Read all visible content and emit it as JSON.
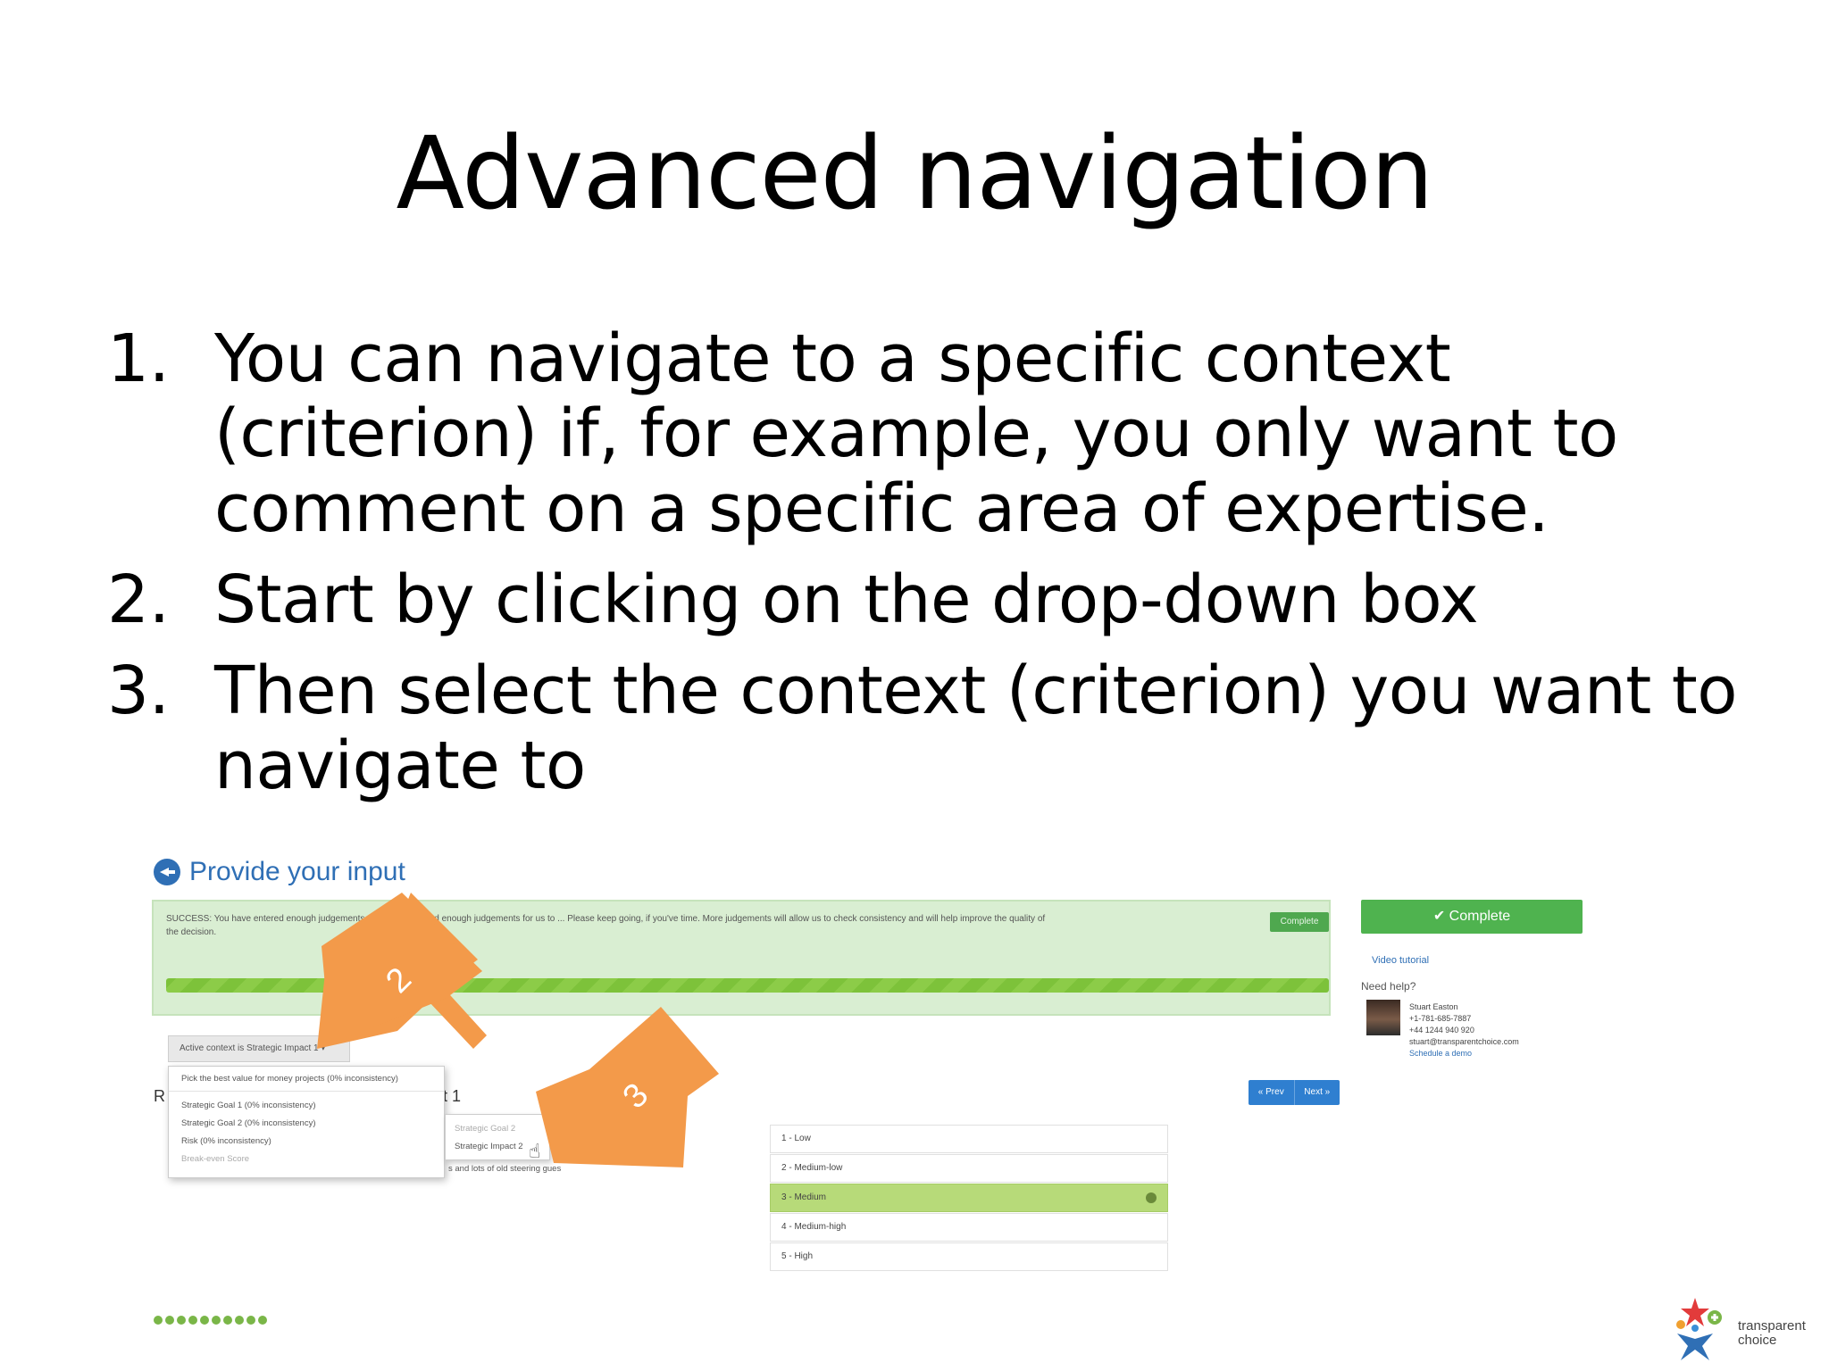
{
  "slide": {
    "title": "Advanced navigation",
    "steps": [
      {
        "num": "1.",
        "text": "You can navigate to a specific context (criterion) if, for example, you only want to comment on a specific area of expertise."
      },
      {
        "num": "2.",
        "text": "Start by clicking on the drop-down box"
      },
      {
        "num": "3.",
        "text": "Then select the context (criterion) you want to navigate to"
      }
    ]
  },
  "screenshot": {
    "heading": "Provide your input",
    "success_message": "SUCCESS: You have entered enough judgements. You have entered enough judgements for us to ... Please keep going, if you've time. More judgements will allow us to check consistency and will help improve the quality of the decision.",
    "complete_small": "Complete",
    "complete_main": "✔ Complete",
    "video_tutorial": "Video tutorial",
    "need_help": "Need help?",
    "contact": {
      "name": "Stuart Easton",
      "phone_us": "+1-781-685-7887",
      "phone_uk": "+44 1244 940 920",
      "email": "stuart@transparentchoice.com",
      "schedule": "Schedule a demo"
    },
    "context_dropdown": "Active context is Strategic Impact 1 ▾",
    "menu_header": "Pick the best value for money projects (0% inconsistency)",
    "menu_items": [
      "Strategic Goal 1 (0% inconsistency)",
      "Strategic Goal 2 (0% inconsistency)",
      "Risk (0% inconsistency)"
    ],
    "menu_item_muted": "Break-even Score",
    "submenu_items": [
      "Strategic Goal 2",
      "Strategic Impact 2"
    ],
    "row_fragment_left": "R",
    "row_fragment_right": "t 1",
    "fragment_text": "s and lots of old steering gues",
    "prev_label": "« Prev",
    "next_label": "Next »",
    "scale": [
      "1 - Low",
      "2 - Medium-low",
      "3 - Medium",
      "4 - Medium-high",
      "5 - High"
    ],
    "selected_scale_index": 2
  },
  "arrows": {
    "left": "2",
    "right": "3"
  },
  "logo": {
    "line1": "transparent",
    "line2": "choice"
  },
  "colors": {
    "accent_blue": "#2f6fb5",
    "success_green": "#4fb34f",
    "arrow_orange": "#f39a4a",
    "selected_row": "#b7da79"
  }
}
